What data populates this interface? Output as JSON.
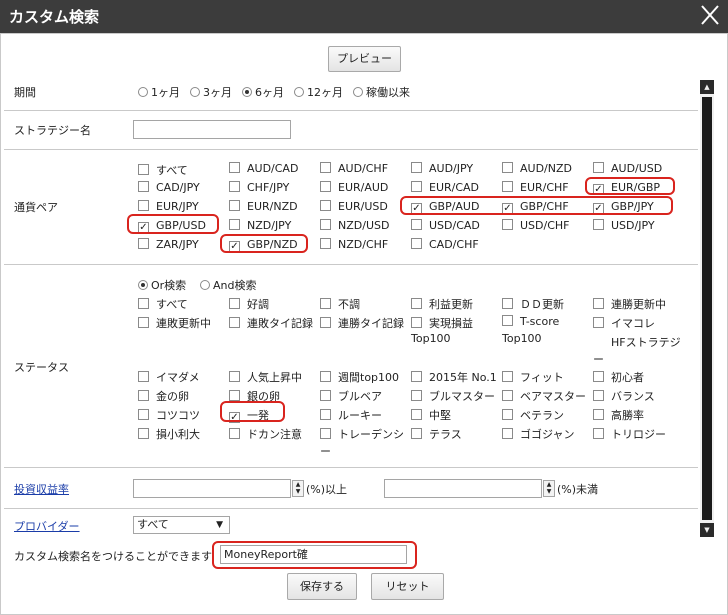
{
  "dialog": {
    "title": "カスタム検索",
    "close_icon": "close-icon"
  },
  "preview_label": "プレビュー",
  "period": {
    "label": "期間",
    "options": [
      "1ヶ月",
      "3ヶ月",
      "6ヶ月",
      "12ヶ月",
      "稼働以来"
    ],
    "selected": "6ヶ月"
  },
  "strategy": {
    "label": "ストラテジー名",
    "value": ""
  },
  "currency": {
    "label": "通貨ペア",
    "items": [
      {
        "label": "すべて",
        "checked": false
      },
      {
        "label": "AUD/CAD",
        "checked": false
      },
      {
        "label": "AUD/CHF",
        "checked": false
      },
      {
        "label": "AUD/JPY",
        "checked": false
      },
      {
        "label": "AUD/NZD",
        "checked": false
      },
      {
        "label": "AUD/USD",
        "checked": false
      },
      {
        "label": "CAD/JPY",
        "checked": false
      },
      {
        "label": "CHF/JPY",
        "checked": false
      },
      {
        "label": "EUR/AUD",
        "checked": false
      },
      {
        "label": "EUR/CAD",
        "checked": false
      },
      {
        "label": "EUR/CHF",
        "checked": false
      },
      {
        "label": "EUR/GBP",
        "checked": true
      },
      {
        "label": "EUR/JPY",
        "checked": false
      },
      {
        "label": "EUR/NZD",
        "checked": false
      },
      {
        "label": "EUR/USD",
        "checked": false
      },
      {
        "label": "GBP/AUD",
        "checked": true
      },
      {
        "label": "GBP/CHF",
        "checked": true
      },
      {
        "label": "GBP/JPY",
        "checked": true
      },
      {
        "label": "GBP/USD",
        "checked": true
      },
      {
        "label": "NZD/JPY",
        "checked": false
      },
      {
        "label": "NZD/USD",
        "checked": false
      },
      {
        "label": "USD/CAD",
        "checked": false
      },
      {
        "label": "USD/CHF",
        "checked": false
      },
      {
        "label": "USD/JPY",
        "checked": false
      },
      {
        "label": "ZAR/JPY",
        "checked": false
      },
      {
        "label": "GBP/NZD",
        "checked": true
      },
      {
        "label": "NZD/CHF",
        "checked": false
      },
      {
        "label": "CAD/CHF",
        "checked": false
      }
    ]
  },
  "status": {
    "label": "ステータス",
    "modes": [
      "Or検索",
      "And検索"
    ],
    "mode_selected": "Or検索",
    "items": [
      {
        "label": "すべて",
        "checked": false
      },
      {
        "label": "好調",
        "checked": false
      },
      {
        "label": "不調",
        "checked": false
      },
      {
        "label": "利益更新",
        "checked": false
      },
      {
        "label": "ＤＤ更新",
        "checked": false
      },
      {
        "label": "連勝更新中",
        "checked": false
      },
      {
        "label": "連敗更新中",
        "checked": false
      },
      {
        "label": "連敗タイ記録",
        "checked": false
      },
      {
        "label": "連勝タイ記録",
        "checked": false
      },
      {
        "label": "実現損益",
        "checked": false,
        "line2": "Top100"
      },
      {
        "label": "T-score",
        "checked": false,
        "line2": "Top100"
      },
      {
        "label": "イマコレ",
        "checked": false
      },
      {
        "label": "HFストラテジ",
        "checked": false,
        "line2": "ー",
        "nobox": true
      },
      {
        "label": "イマダメ",
        "checked": false
      },
      {
        "label": "人気上昇中",
        "checked": false
      },
      {
        "label": "週間top100",
        "checked": false
      },
      {
        "label": "2015年 No.1",
        "checked": false
      },
      {
        "label": "フィット",
        "checked": false
      },
      {
        "label": "初心者",
        "checked": false
      },
      {
        "label": "金の卵",
        "checked": false
      },
      {
        "label": "銀の卵",
        "checked": false
      },
      {
        "label": "ブルベア",
        "checked": false
      },
      {
        "label": "ブルマスター",
        "checked": false
      },
      {
        "label": "ベアマスター",
        "checked": false
      },
      {
        "label": "バランス",
        "checked": false
      },
      {
        "label": "コツコツ",
        "checked": false
      },
      {
        "label": "一発",
        "checked": true
      },
      {
        "label": "ルーキー",
        "checked": false
      },
      {
        "label": "中堅",
        "checked": false
      },
      {
        "label": "ベテラン",
        "checked": false
      },
      {
        "label": "高勝率",
        "checked": false
      },
      {
        "label": "損小利大",
        "checked": false
      },
      {
        "label": "ドカン注意",
        "checked": false
      },
      {
        "label": "トレーデンシ",
        "checked": false,
        "line2": "ー"
      },
      {
        "label": "テラス",
        "checked": false
      },
      {
        "label": "ゴゴジャン",
        "checked": false
      },
      {
        "label": "トリロジー",
        "checked": false
      }
    ]
  },
  "return_rate": {
    "label": "投資収益率",
    "min_value": "",
    "max_value": "",
    "min_suffix": "(%)以上",
    "max_suffix": "(%)未満"
  },
  "provider": {
    "label": "プロバイダー",
    "selected": "すべて",
    "arrow": "▼"
  },
  "custom_name": {
    "label": "カスタム検索名をつけることができます",
    "value": "MoneyReport確"
  },
  "save_label": "保存する",
  "reset_label": "リセット",
  "colors": {
    "titlebar": "#3c3c3c",
    "highlight": "#d9241e",
    "link": "#1a3ca8"
  }
}
